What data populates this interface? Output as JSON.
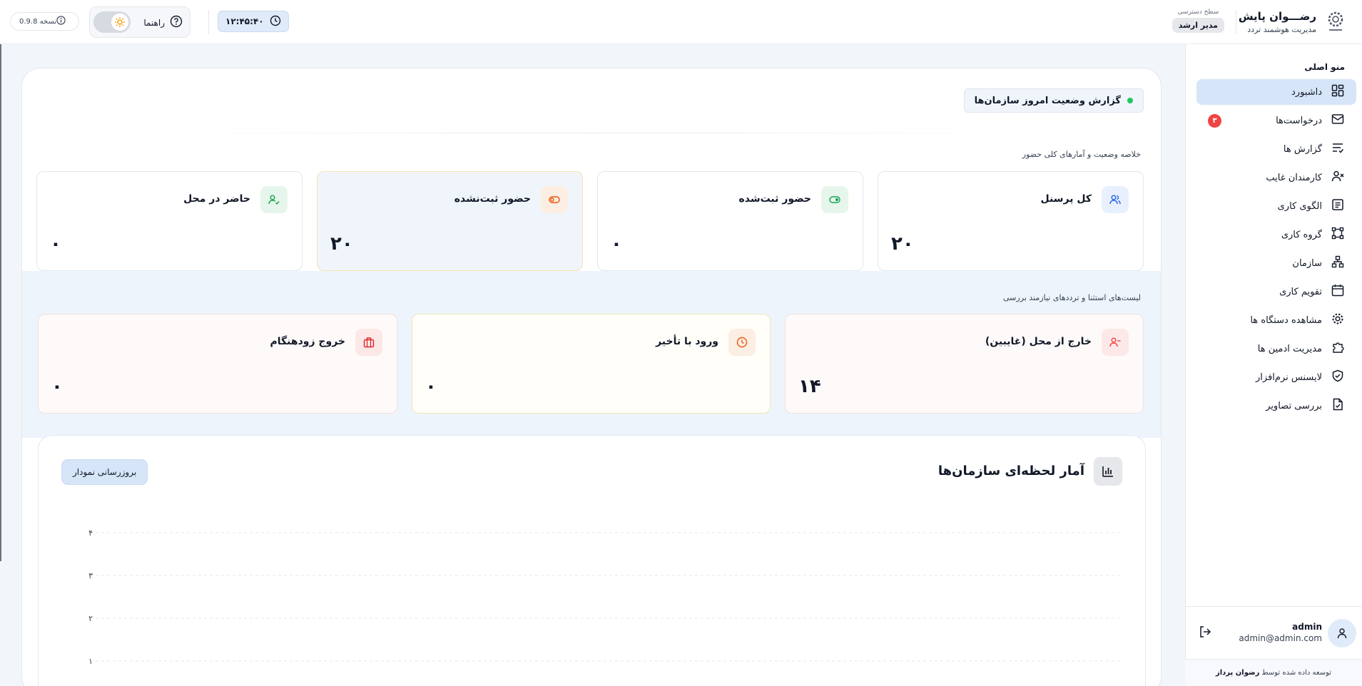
{
  "header": {
    "brand_name": "رضـــوان پایش",
    "brand_sub": "مدیریت هوشمند تردد",
    "access_label": "سطح دسترسی",
    "access_role": "مدیر ارشد",
    "clock": "۱۲:۴۵:۴۰",
    "help_label": "راهنما",
    "version": "نسخه 0.9.8"
  },
  "sidebar": {
    "menu_title": "منو اصلی",
    "items": [
      {
        "label": "داشبورد",
        "icon": "dashboard-icon",
        "active": true
      },
      {
        "label": "درخواست‌ها",
        "icon": "inbox-icon",
        "badge": "۳"
      },
      {
        "label": "گزارش ها",
        "icon": "list-check-icon"
      },
      {
        "label": "کارمندان غایب",
        "icon": "user-x-icon"
      },
      {
        "label": "الگوی کاری",
        "icon": "document-icon"
      },
      {
        "label": "گروه کاری",
        "icon": "group-frame-icon"
      },
      {
        "label": "سازمان",
        "icon": "org-chart-icon"
      },
      {
        "label": "تقویم کاری",
        "icon": "calendar-icon"
      },
      {
        "label": "مشاهده دستگاه ها",
        "icon": "gear-icon"
      },
      {
        "label": "مدیریت ادمین ها",
        "icon": "puzzle-icon"
      },
      {
        "label": "لایسنس نرم‌افزار",
        "icon": "shield-check-icon"
      },
      {
        "label": "بررسی تصاویر",
        "icon": "file-image-icon"
      }
    ],
    "user_name": "admin",
    "user_email": "admin@admin.com",
    "footer_prefix": "توسعه داده شده توسط",
    "footer_company": "رضوان پرداز"
  },
  "main": {
    "report_title": "گزارش وضعیت امروز سازمان‌ها",
    "summary_title": "خلاصه وضعیت و آمارهای کلی حضور",
    "summary_cards": [
      {
        "label": "کل پرسنل",
        "value": "۲۰",
        "icon": "users-icon",
        "color": "#2563eb"
      },
      {
        "label": "حضور ثبت‌شده",
        "value": "۰",
        "icon": "toggle-on-icon",
        "color": "#16a34a"
      },
      {
        "label": "حضور ثبت‌نشده",
        "value": "۲۰",
        "icon": "toggle-off-icon",
        "color": "#ea580c"
      },
      {
        "label": "حاضر در محل",
        "value": "۰",
        "icon": "user-check-icon",
        "color": "#16a34a"
      }
    ],
    "exceptions_title": "لیست‌های استثنا و ترددهای نیازمند بررسی",
    "exception_cards": [
      {
        "label": "خارج از محل (غایبین)",
        "value": "۱۴",
        "icon": "user-minus-icon",
        "color": "#ef4444"
      },
      {
        "label": "ورود با تأخیر",
        "value": "۰",
        "icon": "clock-icon",
        "color": "#ea580c"
      },
      {
        "label": "خروج زودهنگام",
        "value": "۰",
        "icon": "briefcase-icon",
        "color": "#dc2626"
      }
    ],
    "chart_title": "آمار لحظه‌ای سازمان‌ها",
    "refresh_label": "بروزرسانی نمودار"
  },
  "chart_data": {
    "type": "bar",
    "title": "آمار لحظه‌ای سازمان‌ها",
    "y_ticks": [
      "۱",
      "۲",
      "۳",
      "۴"
    ],
    "ylim": [
      0,
      4
    ],
    "grid": true,
    "categories": [],
    "series": []
  }
}
